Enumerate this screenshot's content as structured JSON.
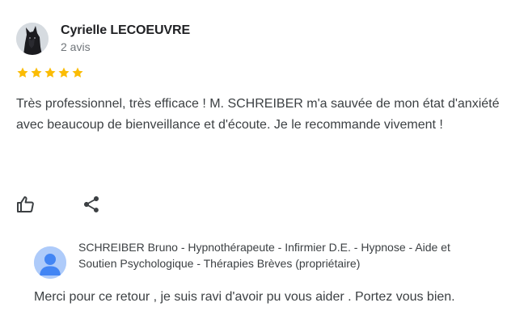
{
  "review": {
    "author_name": "Cyrielle LECOEUVRE",
    "author_meta": "2 avis",
    "rating": 5,
    "rating_max": 5,
    "star_color": "#fbbc04",
    "text": "Très professionnel, très efficace ! M. SCHREIBER m'a sauvée de mon état d'anxiété avec beaucoup de bienveillance et d'écoute. Je le recommande vivement !"
  },
  "actions": {
    "like_icon": "thumbs-up-icon",
    "share_icon": "share-icon"
  },
  "owner_response": {
    "owner_name": "SCHREIBER Bruno - Hypnothérapeute - Infirmier D.E. - Hypnose - Aide et Soutien Psychologique - Thérapies Brèves (propriétaire)",
    "text": "Merci pour ce retour , je suis ravi d'avoir pu vous aider . Portez vous bien.",
    "avatar_color": "#aecbfa",
    "avatar_figure_color": "#4285f4"
  }
}
